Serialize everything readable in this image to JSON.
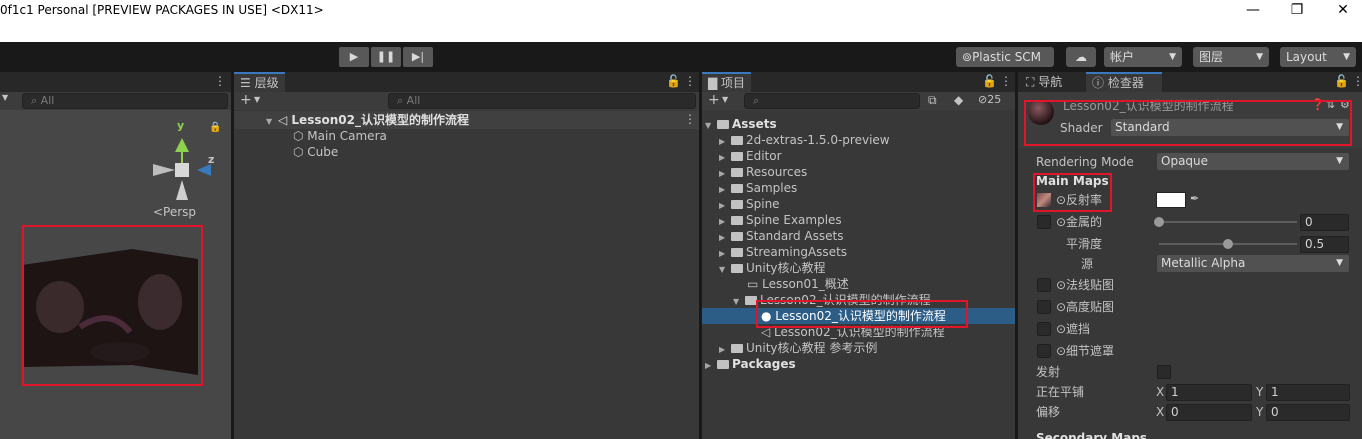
{
  "window": {
    "title": "0f1c1 Personal [PREVIEW PACKAGES IN USE] <DX11>",
    "controls": [
      "—",
      "❐",
      "✕"
    ]
  },
  "toolbar": {
    "play_icon": "▶",
    "pause_icon": "❚❚",
    "step_icon": "▶|",
    "plastic": "Plastic SCM",
    "account": "帐户",
    "layers": "图层",
    "layout": "Layout"
  },
  "scene": {
    "search_placeholder": "All",
    "axis_y": "y",
    "axis_z": "z",
    "persp": "<Persp"
  },
  "hierarchy": {
    "tab": "层级",
    "add_label": "+",
    "search_placeholder": "All",
    "scene_name": "Lesson02_认识模型的制作流程",
    "items": [
      "Main Camera",
      "Cube"
    ]
  },
  "project": {
    "tab": "项目",
    "add_label": "+",
    "hidden_count": "25",
    "root": "Assets",
    "folders": [
      "2d-extras-1.5.0-preview",
      "Editor",
      "Resources",
      "Samples",
      "Spine",
      "Spine Examples",
      "Standard Assets",
      "StreamingAssets"
    ],
    "unity_folder": "Unity核心教程",
    "lesson01": "Lesson01_概述",
    "lesson02_folder": "Lesson02_认识模型的制作流程",
    "lesson02_material": "Lesson02_认识模型的制作流程",
    "lesson02_scene": "Lesson02_认识模型的制作流程",
    "unity_ref": "Unity核心教程 参考示例",
    "packages": "Packages"
  },
  "inspector": {
    "nav_tab": "导航",
    "inspector_tab": "检查器",
    "material_name": "Lesson02_认识模型的制作流程",
    "shader_label": "Shader",
    "shader_value": "Standard",
    "rendering_mode_label": "Rendering Mode",
    "rendering_mode_value": "Opaque",
    "main_maps": "Main Maps",
    "albedo": "⊙反射率",
    "metallic": "⊙金属的",
    "metallic_value": "0",
    "metallic_fraction": 0.0,
    "smoothness": "平滑度",
    "smoothness_value": "0.5",
    "smoothness_fraction": 0.5,
    "source": "源",
    "source_value": "Metallic Alpha",
    "normal_map": "⊙法线贴图",
    "height_map": "⊙高度贴图",
    "occlusion": "⊙遮挡",
    "detail_mask": "⊙细节遮罩",
    "emission": "发射",
    "tiling": "正在平铺",
    "offset": "偏移",
    "x_label": "X",
    "y_label": "Y",
    "tiling_x": "1",
    "tiling_y": "1",
    "offset_x": "0",
    "offset_y": "0",
    "secondary_maps": "Secondary Maps"
  },
  "colors": {
    "accent": "#3a79bb",
    "selection": "#2c5d87",
    "highlight_box": "#e0142a",
    "albedo_color": "#ffffff"
  }
}
